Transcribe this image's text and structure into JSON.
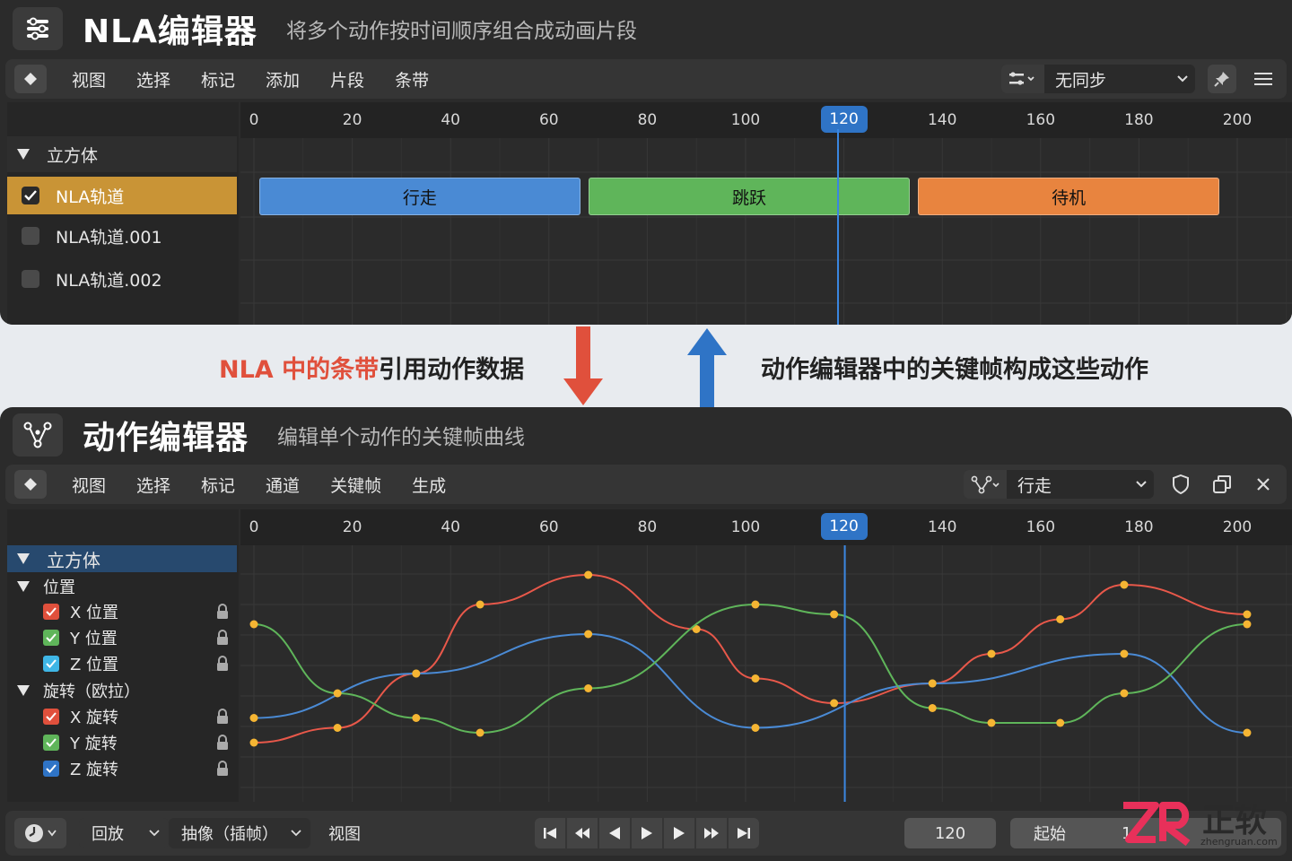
{
  "nla": {
    "title": "NLA编辑器",
    "subtitle": "将多个动作按时间顺序组合成动画片段",
    "menu": [
      "视图",
      "选择",
      "标记",
      "添加",
      "片段",
      "条带"
    ],
    "sync_label": "无同步",
    "object_name": "立方体",
    "tracks": [
      {
        "label": "NLA轨道",
        "checked": true,
        "active": true
      },
      {
        "label": "NLA轨道.001",
        "checked": false,
        "active": false
      },
      {
        "label": "NLA轨道.002",
        "checked": false,
        "active": false
      }
    ],
    "strips": [
      {
        "label": "行走",
        "start": 0,
        "end": 66,
        "color": "#4a8ad4"
      },
      {
        "label": "跳跃",
        "start": 67,
        "end": 133,
        "color": "#5fb55a"
      },
      {
        "label": "待机",
        "start": 134,
        "end": 196,
        "color": "#e8843f"
      }
    ]
  },
  "ruler": {
    "ticks": [
      0,
      20,
      40,
      60,
      80,
      100,
      120,
      140,
      160,
      180,
      200
    ],
    "current_frame": "120"
  },
  "middle": {
    "left_highlight": "NLA 中的条带",
    "left_rest": "引用动作数据",
    "right_text": "动作编辑器中的关键帧构成这些动作",
    "down_color": "#e0503c",
    "up_color": "#2f74c6"
  },
  "action": {
    "title": "动作编辑器",
    "subtitle": "编辑单个动作的关键帧曲线",
    "menu": [
      "视图",
      "选择",
      "标记",
      "通道",
      "关键帧",
      "生成"
    ],
    "action_name": "行走",
    "object_name": "立方体",
    "groups": [
      {
        "label": "位置",
        "channels": [
          {
            "label": "X 位置",
            "color": "#e0503c"
          },
          {
            "label": "Y 位置",
            "color": "#5fb55a"
          },
          {
            "label": "Z 位置",
            "color": "#3fb6e6"
          }
        ]
      },
      {
        "label": "旋转（欧拉）",
        "channels": [
          {
            "label": "X 旋转",
            "color": "#e0503c"
          },
          {
            "label": "Y 旋转",
            "color": "#5fb55a"
          },
          {
            "label": "Z 旋转",
            "color": "#2f74c6"
          }
        ]
      }
    ]
  },
  "curves": [
    {
      "color": "#e8584a",
      "keys": [
        [
          0,
          -0.7
        ],
        [
          17,
          -0.55
        ],
        [
          33,
          0.0
        ],
        [
          46,
          0.7
        ],
        [
          68,
          1.0
        ],
        [
          90,
          0.45
        ],
        [
          102,
          -0.05
        ],
        [
          118,
          -0.3
        ],
        [
          138,
          -0.1
        ],
        [
          150,
          0.2
        ],
        [
          164,
          0.55
        ],
        [
          177,
          0.9
        ],
        [
          202,
          0.6
        ]
      ]
    },
    {
      "color": "#4a8ad4",
      "keys": [
        [
          0,
          -0.45
        ],
        [
          33,
          0.0
        ],
        [
          68,
          0.4
        ],
        [
          102,
          -0.55
        ],
        [
          138,
          -0.1
        ],
        [
          177,
          0.2
        ],
        [
          202,
          -0.6
        ]
      ]
    },
    {
      "color": "#5fb55a",
      "keys": [
        [
          0,
          0.5
        ],
        [
          17,
          -0.2
        ],
        [
          33,
          -0.45
        ],
        [
          46,
          -0.6
        ],
        [
          68,
          -0.15
        ],
        [
          102,
          0.7
        ],
        [
          118,
          0.6
        ],
        [
          138,
          -0.35
        ],
        [
          150,
          -0.5
        ],
        [
          164,
          -0.5
        ],
        [
          177,
          -0.2
        ],
        [
          202,
          0.5
        ]
      ]
    }
  ],
  "footer": {
    "playback": "回放",
    "keying": "抽像（插帧）",
    "view": "视图",
    "frame": "120",
    "start_label": "起始",
    "start_value": "1"
  },
  "watermark": {
    "brand": "正软",
    "site": "zhengruan.com",
    "mark": "ZR"
  }
}
